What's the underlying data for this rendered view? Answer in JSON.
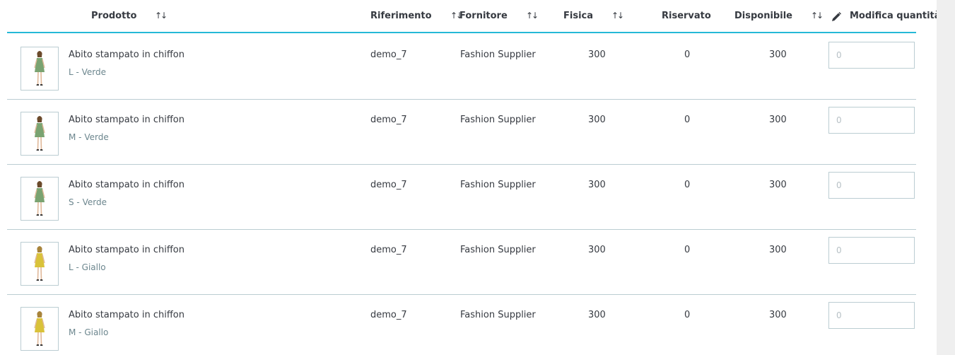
{
  "header": {
    "product": "Prodotto",
    "reference": "Riferimento",
    "supplier": "Fornitore",
    "physical": "Fisica",
    "reserved": "Riservato",
    "available": "Disponibile",
    "edit_quantity": "Modifica quantità",
    "sort_glyph": "↑↓"
  },
  "colors": {
    "accent": "#25b9d7",
    "text": "#363a41",
    "muted": "#6c868e",
    "border": "#bbcdd2"
  },
  "rows": [
    {
      "name": "Abito stampato in chiffon",
      "variant": "L - Verde",
      "reference": "demo_7",
      "supplier": "Fashion Supplier",
      "physical": "300",
      "reserved": "0",
      "available": "300",
      "placeholder": "0",
      "dress_color": "green"
    },
    {
      "name": "Abito stampato in chiffon",
      "variant": "M - Verde",
      "reference": "demo_7",
      "supplier": "Fashion Supplier",
      "physical": "300",
      "reserved": "0",
      "available": "300",
      "placeholder": "0",
      "dress_color": "green"
    },
    {
      "name": "Abito stampato in chiffon",
      "variant": "S - Verde",
      "reference": "demo_7",
      "supplier": "Fashion Supplier",
      "physical": "300",
      "reserved": "0",
      "available": "300",
      "placeholder": "0",
      "dress_color": "green"
    },
    {
      "name": "Abito stampato in chiffon",
      "variant": "L - Giallo",
      "reference": "demo_7",
      "supplier": "Fashion Supplier",
      "physical": "300",
      "reserved": "0",
      "available": "300",
      "placeholder": "0",
      "dress_color": "yellow"
    },
    {
      "name": "Abito stampato in chiffon",
      "variant": "M - Giallo",
      "reference": "demo_7",
      "supplier": "Fashion Supplier",
      "physical": "300",
      "reserved": "0",
      "available": "300",
      "placeholder": "0",
      "dress_color": "yellow"
    }
  ]
}
